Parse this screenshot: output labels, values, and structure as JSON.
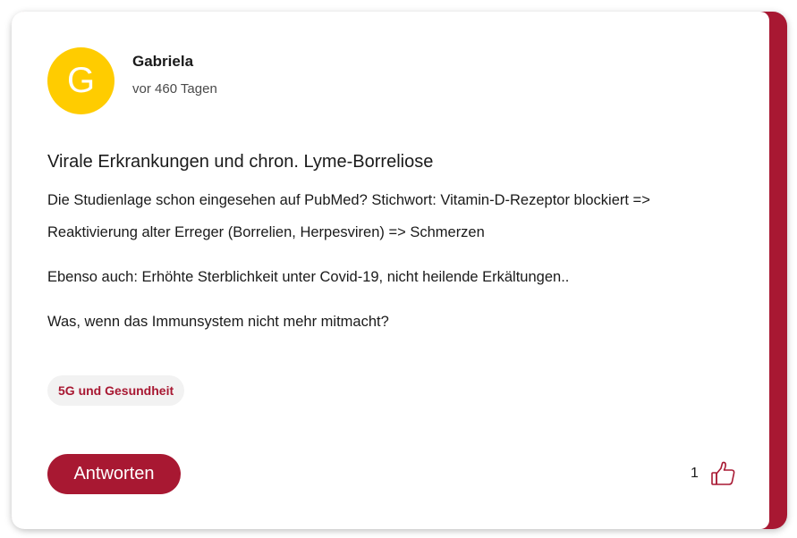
{
  "author": {
    "initial": "G",
    "name": "Gabriela",
    "time": "vor 460 Tagen",
    "avatar_color": "#ffcc00"
  },
  "post": {
    "title": "Virale Erkrankungen und chron. Lyme-Borreliose",
    "paragraphs": [
      "Die Studienlage schon eingesehen auf PubMed? Stichwort: Vitamin-D-Rezeptor blockiert => Reaktivierung alter Erreger (Borrelien, Herpesviren) => Schmerzen",
      "Ebenso auch: Erhöhte Sterblichkeit unter Covid-19, nicht heilende Erkältungen..",
      "Was, wenn das Immunsystem nicht mehr mitmacht?"
    ],
    "tag": "5G und Gesundheit"
  },
  "actions": {
    "reply_label": "Antworten",
    "like_count": "1",
    "like_icon": "thumbs-up-icon"
  },
  "colors": {
    "accent": "#a81832",
    "tag_bg": "#f2f2f2"
  }
}
